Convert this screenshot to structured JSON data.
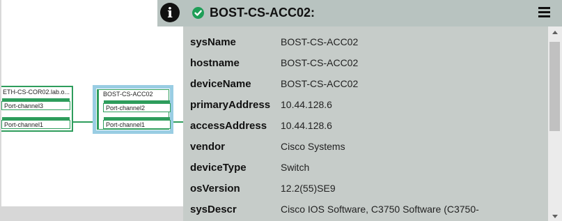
{
  "topology": {
    "left_node": {
      "title": "ETH-CS-COR02.lab.o...",
      "ports": [
        "Port-channel3",
        "Port-channel1"
      ]
    },
    "right_node": {
      "title": "BOST-CS-ACC02",
      "ports": [
        "Port-channel2",
        "Port-channel1"
      ]
    }
  },
  "panel": {
    "info_icon_glyph": "i",
    "status": "ok",
    "title": "BOST-CS-ACC02:",
    "accent_color": "#1e9e57",
    "rows": [
      {
        "key": "sysName",
        "value": "BOST-CS-ACC02"
      },
      {
        "key": "hostname",
        "value": "BOST-CS-ACC02"
      },
      {
        "key": "deviceName",
        "value": "BOST-CS-ACC02"
      },
      {
        "key": "primaryAddress",
        "value": "10.44.128.6"
      },
      {
        "key": "accessAddress",
        "value": "10.44.128.6"
      },
      {
        "key": "vendor",
        "value": "Cisco Systems"
      },
      {
        "key": "deviceType",
        "value": "Switch"
      },
      {
        "key": "osVersion",
        "value": "12.2(55)SE9"
      },
      {
        "key": "sysDescr",
        "value": "Cisco IOS Software, C3750 Software (C3750-"
      }
    ]
  }
}
